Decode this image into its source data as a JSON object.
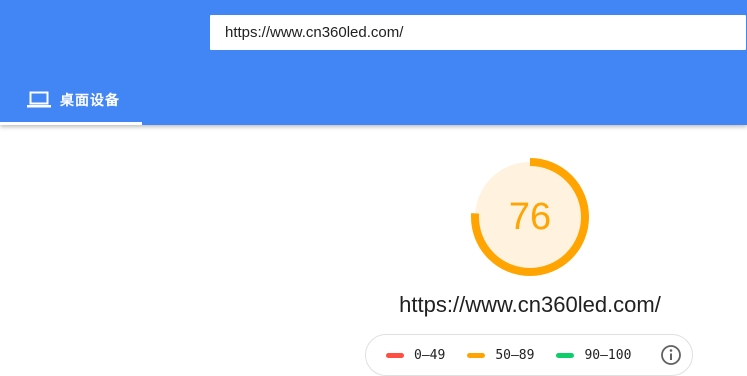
{
  "search": {
    "url_value": "https://www.cn360led.com/"
  },
  "tabs": [
    {
      "label": "桌面设备",
      "icon": "laptop-icon",
      "active": true
    }
  ],
  "report": {
    "score": 76,
    "score_label": "76",
    "score_fraction": 0.76,
    "score_color": "#ffa400",
    "score_bg_color": "#fff3e0",
    "tested_url": "https://www.cn360led.com/"
  },
  "legend": {
    "items": [
      {
        "label": "0–49",
        "color": "#ff4e42"
      },
      {
        "label": "50–89",
        "color": "#ffa400"
      },
      {
        "label": "90–100",
        "color": "#0cce6b"
      }
    ],
    "info_icon": "info-icon"
  },
  "colors": {
    "header": "#4285f4"
  }
}
